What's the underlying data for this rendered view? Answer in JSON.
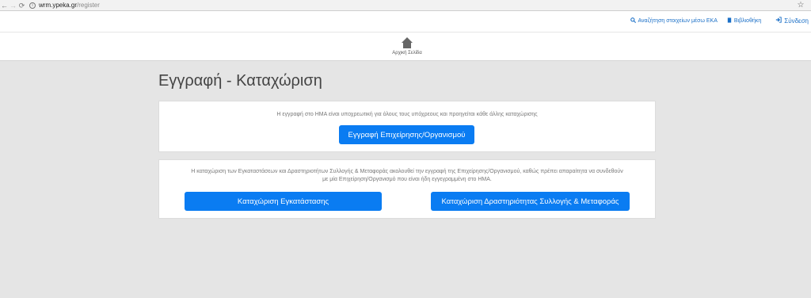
{
  "browser": {
    "url_host": "wrm.ypeka.gr",
    "url_path": "/register",
    "back_glyph": "←",
    "forward_glyph": "→",
    "reload_glyph": "⟳",
    "info_glyph": "i",
    "star_glyph": "☆"
  },
  "header": {
    "links": {
      "search_eka": "Αναζήτηση στοιχείων μέσω ΕΚΑ",
      "library": "Βιβλιοθήκη",
      "login": "Σύνδεση"
    },
    "icons": {
      "search": "🔍",
      "book": "▮",
      "login": "➔"
    }
  },
  "homenav": {
    "home_label": "Αρχική Σελίδα"
  },
  "page": {
    "title": "Εγγραφή - Καταχώριση"
  },
  "card1": {
    "text": "Η εγγραφή στο ΗΜΑ είναι υποχρεωτική για όλους τους υπόχρεους και προηγείται κάθε άλλης καταχώρισης",
    "button": "Εγγραφή Επιχείρησης/Οργανισμού"
  },
  "card2": {
    "text": "Η καταχώριση των Εγκαταστάσεων και Δραστηριοτήτων Συλλογής & Μεταφοράς ακολουθεί την εγγραφή της Επιχείρησης/Οργανισμού, καθώς πρέπει απαραίτητα να συνδεθούν με μία Επιχείρηση/Οργανισμό που είναι ήδη εγγεγραμμένη στο ΗΜΑ.",
    "button_facility": "Καταχώριση Εγκατάστασης",
    "button_activity": "Καταχώριση Δραστηριότητας Συλλογής & Μεταφοράς"
  },
  "colors": {
    "primary": "#0a7cf2",
    "link": "#1a6fc7",
    "background": "#e5e5e5"
  }
}
